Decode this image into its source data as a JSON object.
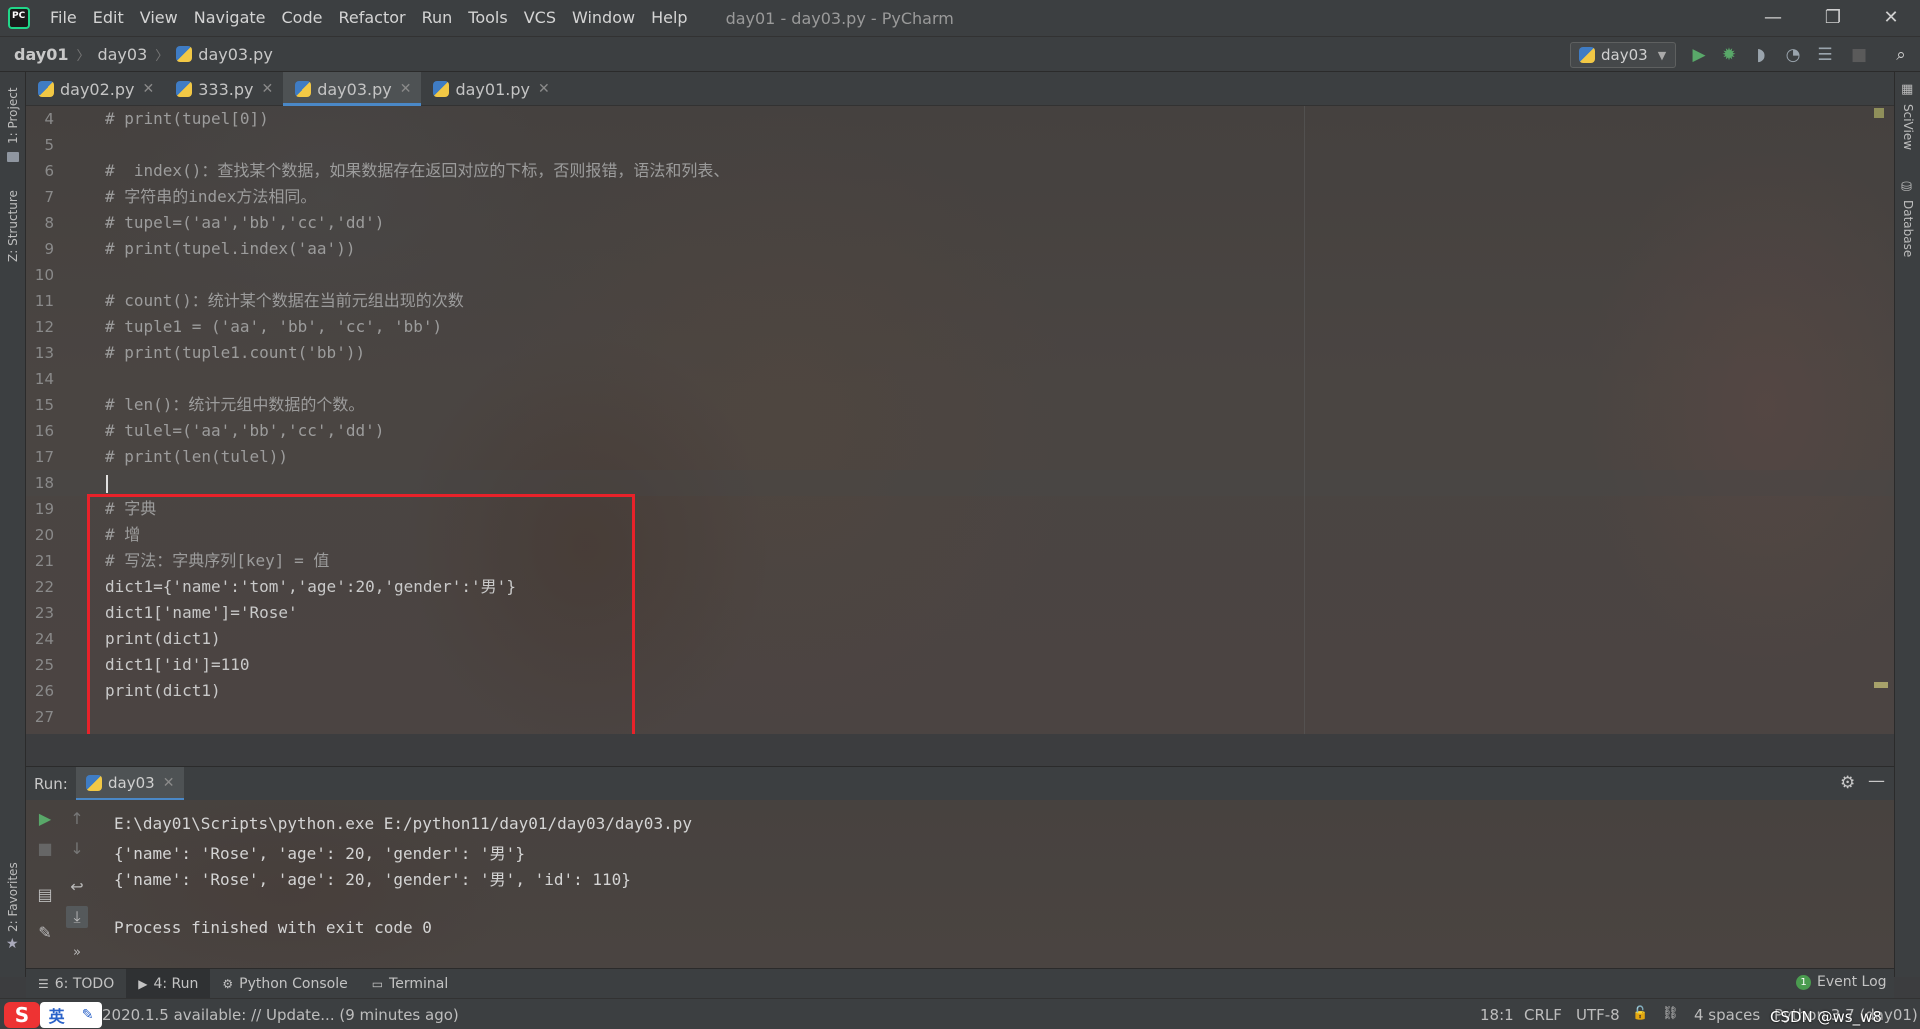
{
  "menu": {
    "items": [
      "File",
      "Edit",
      "View",
      "Navigate",
      "Code",
      "Refactor",
      "Run",
      "Tools",
      "VCS",
      "Window",
      "Help"
    ],
    "window_title": "day01 - day03.py - PyCharm"
  },
  "window_controls": {
    "minimize": "—",
    "restore": "❐",
    "close": "✕"
  },
  "breadcrumb": [
    "day01",
    "day03",
    "day03.py"
  ],
  "run_config": {
    "label": "day03"
  },
  "left_strip": {
    "project": "1: Project",
    "structure": "Z: Structure",
    "favorites": "2: Favorites"
  },
  "right_strip": {
    "sciview": "SciView",
    "database": "Database"
  },
  "tabs": [
    {
      "label": "day02.py",
      "active": false
    },
    {
      "label": "333.py",
      "active": false
    },
    {
      "label": "day03.py",
      "active": true
    },
    {
      "label": "day01.py",
      "active": false
    }
  ],
  "editor": {
    "lines": [
      {
        "n": "4",
        "text": "# print(tupel[0])"
      },
      {
        "n": "5",
        "text": ""
      },
      {
        "n": "6",
        "text": "#  index()：查找某个数据，如果数据存在返回对应的下标，否则报错，语法和列表、"
      },
      {
        "n": "7",
        "text": "# 字符串的index方法相同。"
      },
      {
        "n": "8",
        "text": "# tupel=('aa','bb','cc','dd')"
      },
      {
        "n": "9",
        "text": "# print(tupel.index('aa'))"
      },
      {
        "n": "10",
        "text": ""
      },
      {
        "n": "11",
        "text": "# count()：统计某个数据在当前元组出现的次数"
      },
      {
        "n": "12",
        "text": "# tuple1 = ('aa', 'bb', 'cc', 'bb')"
      },
      {
        "n": "13",
        "text": "# print(tuple1.count('bb'))"
      },
      {
        "n": "14",
        "text": ""
      },
      {
        "n": "15",
        "text": "# len()：统计元组中数据的个数。"
      },
      {
        "n": "16",
        "text": "# tulel=('aa','bb','cc','dd')"
      },
      {
        "n": "17",
        "text": "# print(len(tulel))"
      },
      {
        "n": "18",
        "text": ""
      },
      {
        "n": "19",
        "text": "# 字典"
      },
      {
        "n": "20",
        "text": "# 增"
      },
      {
        "n": "21",
        "text": "# 写法：字典序列[key] = 值"
      },
      {
        "n": "22",
        "text": "dict1={'name':'tom','age':20,'gender':'男'}"
      },
      {
        "n": "23",
        "text": "dict1['name']='Rose'"
      },
      {
        "n": "24",
        "text": "print(dict1)"
      },
      {
        "n": "25",
        "text": "dict1['id']=110"
      },
      {
        "n": "26",
        "text": "print(dict1)"
      },
      {
        "n": "27",
        "text": ""
      }
    ]
  },
  "run_panel": {
    "label": "Run:",
    "tab": "day03",
    "output": [
      "E:\\day01\\Scripts\\python.exe E:/python11/day01/day03/day03.py",
      "{'name': 'Rose', 'age': 20, 'gender': '男'}",
      "{'name': 'Rose', 'age': 20, 'gender': '男', 'id': 110}",
      "",
      "Process finished with exit code 0"
    ]
  },
  "tool_tabs": [
    {
      "label": "6: TODO",
      "icon": "list-icon"
    },
    {
      "label": "4: Run",
      "icon": "play-icon",
      "active": true
    },
    {
      "label": "Python Console",
      "icon": "python-console-icon"
    },
    {
      "label": "Terminal",
      "icon": "terminal-icon"
    }
  ],
  "event_log": {
    "badge": "1",
    "label": "Event Log"
  },
  "status": {
    "update": "2020.1.5 available: // Update... (9 minutes ago)",
    "position": "18:1",
    "line_sep": "CRLF",
    "encoding": "UTF-8",
    "indent": "4 spaces",
    "interpreter": "Python 3.7 (day01)",
    "watermark": "CSDN @ws_w8",
    "ime": "英"
  },
  "colors": {
    "accent": "#4a88c7",
    "highlight_box": "#e8222a",
    "run_green": "#59a869",
    "comment": "#9c9c9c",
    "string": "#6a9956",
    "keyword_builtin": "#8888c6",
    "number": "#6897bb"
  }
}
